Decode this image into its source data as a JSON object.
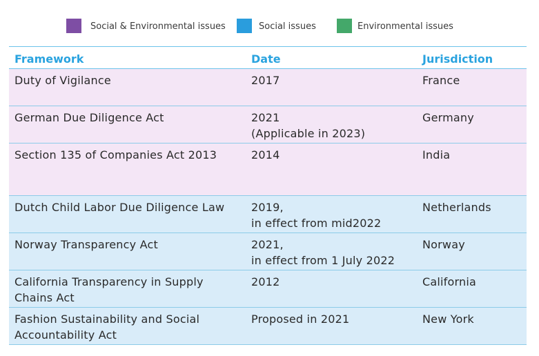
{
  "legend": [
    {
      "label": "Social & Environmental issues",
      "color": "#7e4ea4"
    },
    {
      "label": "Social issues",
      "color": "#2a9ddd"
    },
    {
      "label": "Environmental issues",
      "color": "#44a86a"
    }
  ],
  "colors": {
    "social_environmental_row": "#f4e6f6",
    "social_row": "#d9ecf9",
    "header_text": "#2aa3df",
    "border": "#6cc3ea"
  },
  "table": {
    "headers": {
      "framework": "Framework",
      "date": "Date",
      "jurisdiction": "Jurisdiction"
    },
    "rows": [
      {
        "framework": "Duty of Vigilance",
        "date": "2017",
        "jurisdiction": "France",
        "category": "social_environmental"
      },
      {
        "framework": "German Due Diligence Act",
        "date": "2021\n(Applicable in 2023)",
        "jurisdiction": "Germany",
        "category": "social_environmental"
      },
      {
        "framework": "Section 135 of Companies Act 2013",
        "date": "2014",
        "jurisdiction": "India",
        "category": "social_environmental"
      },
      {
        "framework": "Dutch Child Labor Due Diligence Law",
        "date": "2019,\nin effect from mid2022",
        "jurisdiction": "Netherlands",
        "category": "social"
      },
      {
        "framework": "Norway Transparency Act",
        "date": "2021,\nin effect from 1 July 2022",
        "jurisdiction": "Norway",
        "category": "social"
      },
      {
        "framework": "California Transparency in Supply\nChains Act",
        "date": "2012",
        "jurisdiction": "California",
        "category": "social"
      },
      {
        "framework": "Fashion Sustainability and Social\nAccountability Act",
        "date": "Proposed in 2021",
        "jurisdiction": "New York",
        "category": "social"
      }
    ]
  }
}
